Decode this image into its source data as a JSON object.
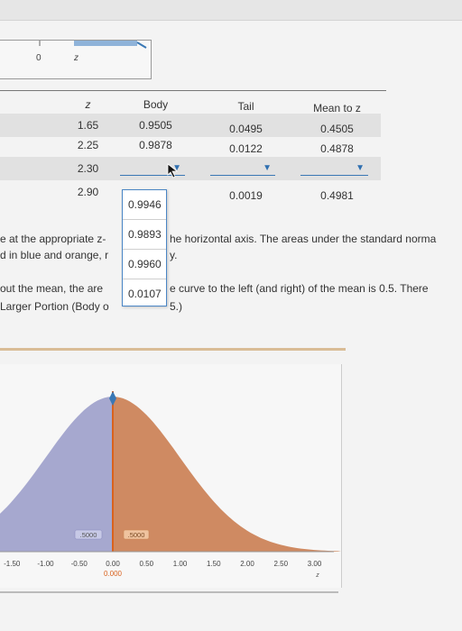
{
  "top": {
    "tick0": "0",
    "tickz": "z"
  },
  "table": {
    "headers": {
      "z": "z",
      "body": "Body",
      "tail": "Tail",
      "mean": "Mean to z"
    },
    "rows": [
      {
        "z": "1.65",
        "body": "0.9505",
        "tail": "0.0495",
        "mean": "0.4505"
      },
      {
        "z": "2.25",
        "body": "0.9878",
        "tail": "0.0122",
        "mean": "0.4878"
      },
      {
        "z": "2.30",
        "body": "",
        "tail": "",
        "mean": ""
      },
      {
        "z": "2.90",
        "body": "",
        "tail": "0.0019",
        "mean": "0.4981"
      }
    ]
  },
  "dropdown": {
    "options": [
      "0.9946",
      "0.9893",
      "0.9960",
      "0.0107"
    ]
  },
  "paragraph": {
    "line1a": "e at the appropriate z-",
    "line1b": "he horizontal axis. The areas under the standard norma",
    "line2a": "d in blue and orange, r",
    "line2b": "y.",
    "line3a": "out the mean, the are",
    "line3b": "e curve to the left (and right) of the mean is 0.5. There",
    "line4a": "Larger Portion (Body o",
    "line4b": "5.)"
  },
  "graph": {
    "left_area": ".5000",
    "right_area": ".5000",
    "x_ticks": [
      "-1.50",
      "-1.00",
      "-0.50",
      "0.00",
      "0.50",
      "1.00",
      "1.50",
      "2.00",
      "2.50",
      "3.00"
    ],
    "marker_value": "0.000",
    "axis_label": "z",
    "colors": {
      "left": "#a6a8cf",
      "right": "#cf8a62",
      "line": "#d9621e"
    }
  }
}
